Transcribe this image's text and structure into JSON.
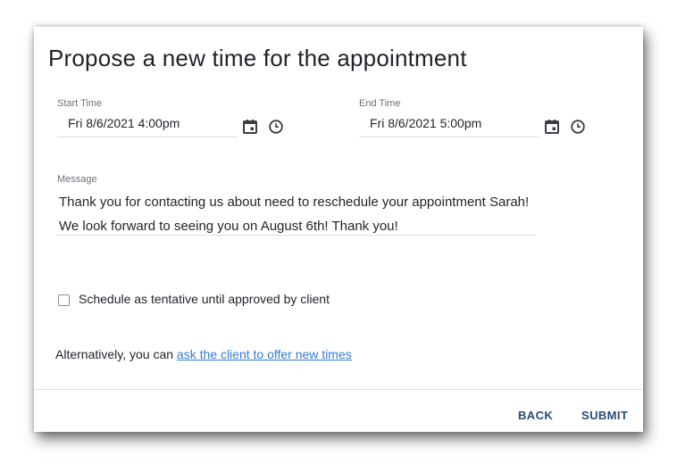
{
  "dialog": {
    "title": "Propose a new time for the appointment"
  },
  "start_time": {
    "label": "Start Time",
    "value": "Fri 8/6/2021 4:00pm",
    "date_icon": "calendar-icon",
    "time_icon": "clock-icon"
  },
  "end_time": {
    "label": "End Time",
    "value": "Fri 8/6/2021 5:00pm",
    "date_icon": "calendar-icon",
    "time_icon": "clock-icon"
  },
  "message": {
    "label": "Message",
    "value": "Thank you for contacting us about need to reschedule your appointment Sarah! We look forward to seeing you on August 6th! Thank you!"
  },
  "tentative": {
    "label": "Schedule as tentative until approved by client",
    "checked": false
  },
  "alternative": {
    "prefix": "Alternatively, you can ",
    "link_text": "ask the client to offer new times"
  },
  "footer": {
    "back_label": "BACK",
    "submit_label": "SUBMIT"
  },
  "colors": {
    "link": "#2f7cd6",
    "button": "#2b4a73",
    "icon": "#3a3d42"
  }
}
